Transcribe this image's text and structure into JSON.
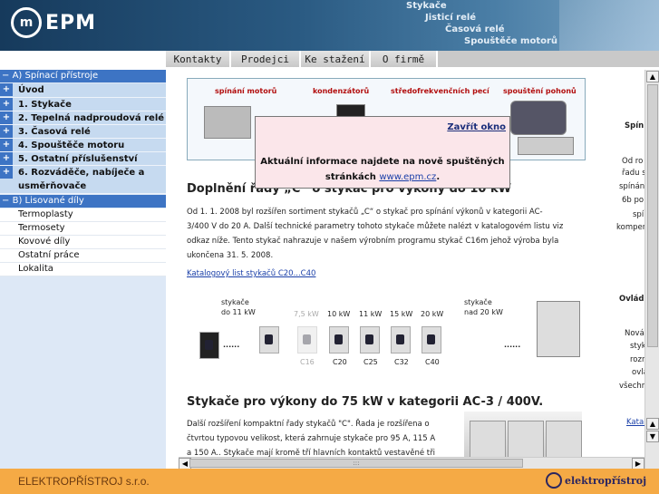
{
  "header": {
    "logo_mark": "m",
    "logo_text": "EPM",
    "links": [
      "Stykače",
      "Jisticí relé",
      "Časová relé",
      "Spouštěče motorů"
    ]
  },
  "tabs": [
    "Kontakty",
    "Prodejci",
    "Ke stažení",
    "O firmě"
  ],
  "sidebar": {
    "section_a": "A) Spínací přístroje",
    "items": [
      "Úvod",
      "1. Stykače",
      "2. Tepelná nadproudová relé",
      "3. Časová relé",
      "4. Spouštěče motoru",
      "5. Ostatní příslušenství"
    ],
    "item6_line1": "6. Rozváděče, nabíječe a",
    "item6_line2": "usměrňovače",
    "section_b": "B) Lisované díly",
    "subitems": [
      "Termoplasty",
      "Termosety",
      "Kovové díly",
      "Ostatní práce",
      "Lokalita"
    ],
    "sign_minus": "−",
    "sign_plus": "+"
  },
  "banner": {
    "captions": [
      "spínání motorů",
      "kondenzátorů",
      "středofrekvenčních pecí",
      "spouštění pohonů"
    ]
  },
  "popup": {
    "close_label": "Zavřít okno",
    "line1": "Aktuální informace najdete na nově spuštěných",
    "line2_prefix": "stránkách ",
    "link": "www.epm.cz",
    "line2_suffix": "."
  },
  "article": {
    "heading1": "Doplnění řady „C“ o stykač pro výkony do 10 kW",
    "para_lines": [
      "Od 1. 1. 2008 byl rozšířen sortiment stykačů „C“ o stykač pro spínání výkonů v kategorii AC-",
      "3/400 V do 20 A. Další technické parametry tohoto stykače můžete nalézt v katalogovém listu viz",
      "odkaz níže. Tento stykač nahrazuje v našem výrobním programu stykač C16m jehož výroba byla",
      "ukončena 31. 5. 2008."
    ],
    "catalog_link": "Katalogový list stykačů C20...C40",
    "heading2": "Stykače pro výkony do 75 kW v kategorii AC-3 / 400V.",
    "para2_lines": [
      "Další rozšíření kompaktní řady stykačů \"C\". Řada je rozšířena o",
      "čtvrtou typovou velikost, která zahrnuje stykače pro 95 A, 115 A",
      "a 150 A.. Stykače mají kromě tří hlavních kontaktů vestavěné tři"
    ]
  },
  "diagram": {
    "left_label_1": "stykače",
    "left_label_2": "do 11 kW",
    "right_label_1": "stykače",
    "right_label_2": "nad 20 kW",
    "dots": "......",
    "powers": [
      "7,5 kW",
      "10 kW",
      "11 kW",
      "15 kW",
      "20 kW"
    ],
    "models": [
      "C16",
      "C20",
      "C25",
      "C32",
      "C40"
    ]
  },
  "right_column": {
    "items": [
      "Spín",
      "Od ro",
      "řadu s",
      "spínán",
      "6b po",
      "spí",
      "kompen",
      "Ovlád",
      "Nová",
      "styk",
      "rozn",
      "ovlá",
      "všechn",
      "Katal"
    ]
  },
  "footer": {
    "company": "ELEKTROPŘÍSTROJ s.r.o.",
    "logo_text": "elektropřístroj"
  },
  "scroll": {
    "up": "▲",
    "down": "▼",
    "left": "◀",
    "right": "▶",
    "grip": ":::"
  },
  "colors": {
    "sidebar_section": "#3d74c4",
    "footer": "#f5aa45",
    "popup_bg": "#fbe6ea"
  }
}
